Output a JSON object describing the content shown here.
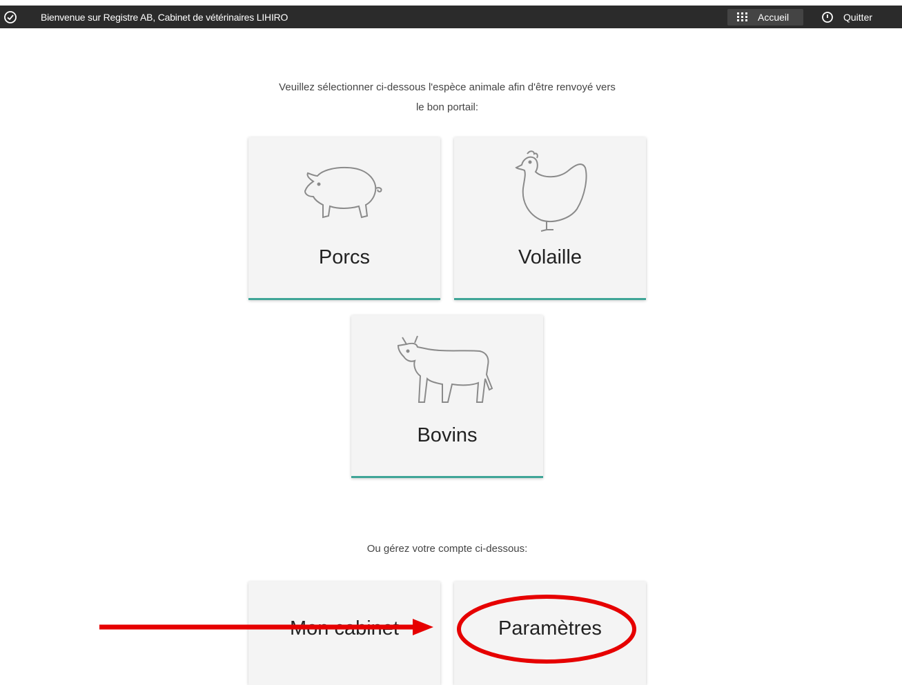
{
  "topbar": {
    "welcome": "Bienvenue sur Registre AB, Cabinet de vétérinaires LIHIRO",
    "accueil_label": "Accueil",
    "quitter_label": "Quitter"
  },
  "main": {
    "intro_line1": "Veuillez sélectionner ci-dessous l'espèce animale afin d'être renvoyé vers",
    "intro_line2": "le bon portail:",
    "species": [
      {
        "label": "Porcs",
        "icon": "pig-icon"
      },
      {
        "label": "Volaille",
        "icon": "chicken-icon"
      },
      {
        "label": "Bovins",
        "icon": "cow-icon"
      }
    ],
    "account_prompt": "Ou gérez votre compte ci-dessous:",
    "account": [
      {
        "label": "Mon cabinet"
      },
      {
        "label": "Paramètres"
      }
    ]
  },
  "colors": {
    "topbar": "#2b2b2b",
    "tile_accent": "#3fa597",
    "annotation": "#e60000"
  }
}
